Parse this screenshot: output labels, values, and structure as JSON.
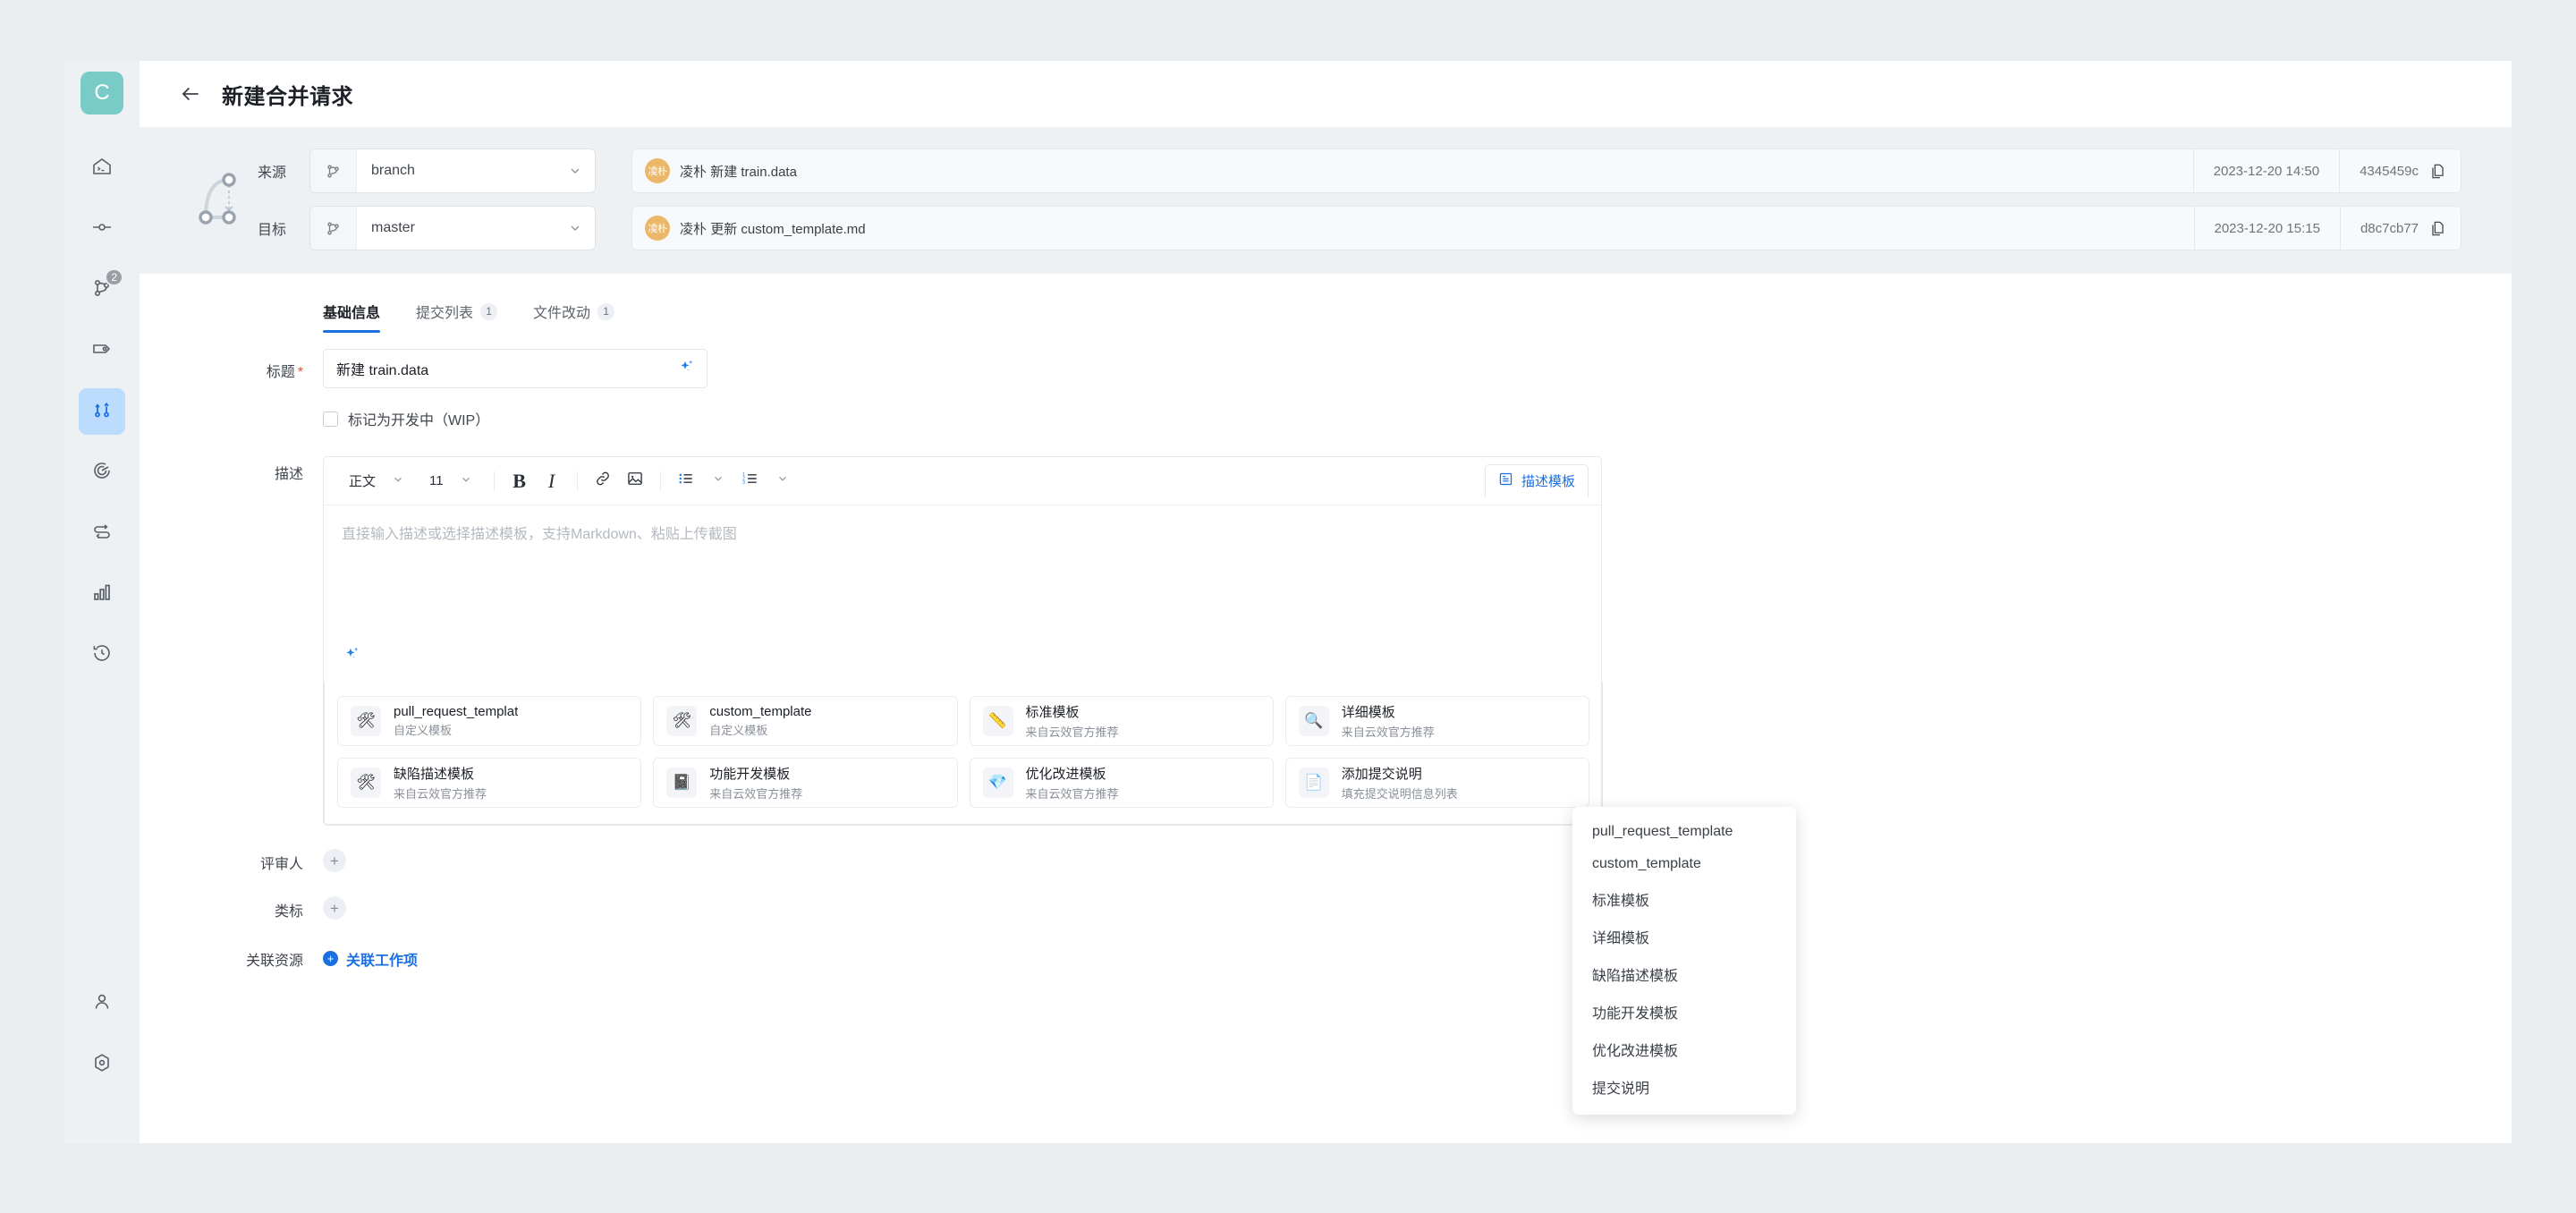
{
  "sidebar": {
    "logo_letter": "C",
    "items": [
      {
        "name": "code-repo-icon",
        "badge": null
      },
      {
        "name": "commit-icon",
        "badge": null
      },
      {
        "name": "branch-icon",
        "badge": "2"
      },
      {
        "name": "tag-icon",
        "badge": null
      },
      {
        "name": "merge-request-icon",
        "badge": null,
        "active": true
      },
      {
        "name": "target-icon",
        "badge": null
      },
      {
        "name": "compare-icon",
        "badge": null
      },
      {
        "name": "statistics-icon",
        "badge": null
      },
      {
        "name": "history-icon",
        "badge": null
      }
    ],
    "bottom_items": [
      {
        "name": "user-icon"
      },
      {
        "name": "settings-icon"
      }
    ]
  },
  "header": {
    "back_label": "←",
    "title": "新建合并请求"
  },
  "branch": {
    "source_label": "来源",
    "source_value": "branch",
    "target_label": "目标",
    "target_value": "master",
    "commits": [
      {
        "author": "凌朴",
        "action": "新建",
        "file": "train.data",
        "date": "2023-12-20 14:50",
        "sha": "4345459c"
      },
      {
        "author": "凌朴",
        "action": "更新",
        "file": "custom_template.md",
        "date": "2023-12-20 15:15",
        "sha": "d8c7cb77"
      }
    ]
  },
  "tabs": [
    {
      "label": "基础信息",
      "count": null,
      "active": true
    },
    {
      "label": "提交列表",
      "count": "1",
      "active": false
    },
    {
      "label": "文件改动",
      "count": "1",
      "active": false
    }
  ],
  "form": {
    "title_label": "标题",
    "title_required": "*",
    "title_value": "新建 train.data",
    "wip_label": "标记为开发中（WIP）",
    "desc_label": "描述",
    "reviewer_label": "评审人",
    "tag_label": "类标",
    "resource_label": "关联资源",
    "link_work_item": "关联工作项",
    "plus": "+"
  },
  "editor": {
    "style_select": "正文",
    "size_select": "11",
    "bold": "B",
    "italic": "I",
    "link_icon": "link-icon",
    "image_icon": "image-icon",
    "bullet_list_icon": "bullet-list-icon",
    "ordered_list_icon": "ordered-list-icon",
    "template_button": "描述模板",
    "placeholder": "直接输入描述或选择描述模板，支持Markdown、粘贴上传截图"
  },
  "dropdown": {
    "items": [
      "pull_request_template",
      "custom_template",
      "标准模板",
      "详细模板",
      "缺陷描述模板",
      "功能开发模板",
      "优化改进模板",
      "提交说明"
    ]
  },
  "templates": [
    {
      "name": "pull_request_templat",
      "sub": "自定义模板",
      "icon": "🛠"
    },
    {
      "name": "custom_template",
      "sub": "自定义模板",
      "icon": "🛠"
    },
    {
      "name": "标准模板",
      "sub": "来自云效官方推荐",
      "icon": "📏"
    },
    {
      "name": "详细模板",
      "sub": "来自云效官方推荐",
      "icon": "🔍"
    },
    {
      "name": "缺陷描述模板",
      "sub": "来自云效官方推荐",
      "icon": "🛠"
    },
    {
      "name": "功能开发模板",
      "sub": "来自云效官方推荐",
      "icon": "📓"
    },
    {
      "name": "优化改进模板",
      "sub": "来自云效官方推荐",
      "icon": "💎"
    },
    {
      "name": "添加提交说明",
      "sub": "填充提交说明信息列表",
      "icon": "📄"
    }
  ],
  "colors": {
    "accent": "#1b6fe0",
    "logo_bg": "#79cbc7",
    "avatar_bg": "#eab868",
    "page_bg": "#e9edf0"
  }
}
